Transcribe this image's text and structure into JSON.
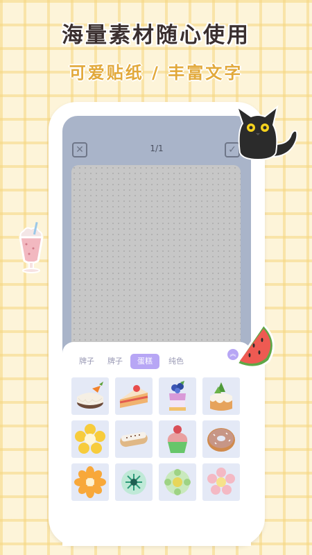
{
  "headline": "海量素材随心使用",
  "subline": "可爱贴纸 / 丰富文字",
  "editor": {
    "page_indicator": "1/1",
    "close_icon": "close-icon",
    "confirm_icon": "check-icon"
  },
  "tabs": [
    {
      "label": "牌子",
      "active": false
    },
    {
      "label": "牌子",
      "active": false
    },
    {
      "label": "蛋糕",
      "active": true
    },
    {
      "label": "纯色",
      "active": false
    }
  ],
  "stickers": [
    {
      "icon": "carrot-cake-icon"
    },
    {
      "icon": "strawberry-cake-slice-icon"
    },
    {
      "icon": "blueberry-cake-icon"
    },
    {
      "icon": "pineapple-cake-icon"
    },
    {
      "icon": "yellow-flower-cookie-icon"
    },
    {
      "icon": "eclair-icon"
    },
    {
      "icon": "cupcake-icon"
    },
    {
      "icon": "donut-icon"
    },
    {
      "icon": "orange-flower-icon"
    },
    {
      "icon": "teal-flower-icon"
    },
    {
      "icon": "green-flower-icon"
    },
    {
      "icon": "pink-flower-icon"
    }
  ],
  "decorations": [
    "black-cat-icon",
    "milkshake-icon",
    "watermelon-icon"
  ],
  "colors": {
    "accent": "#b7a6f5",
    "screen": "#a9b4c9",
    "background": "#fdf4d9",
    "subline": "#e2a93b"
  }
}
